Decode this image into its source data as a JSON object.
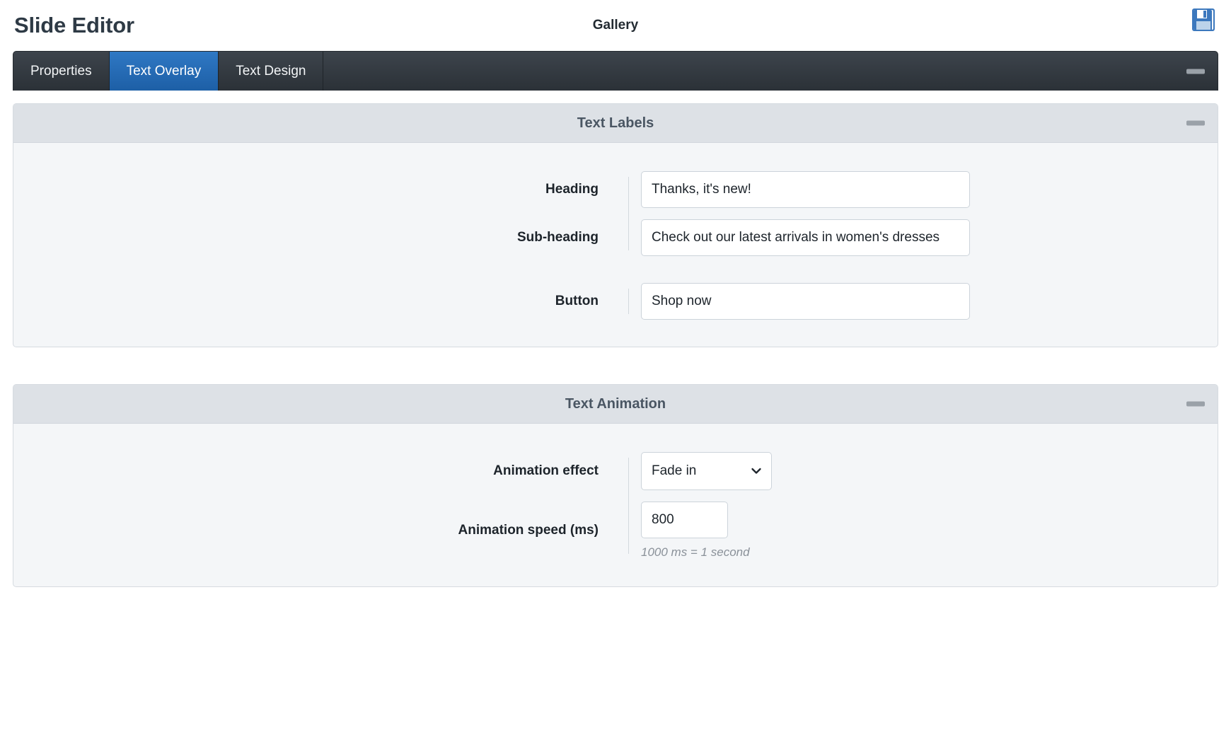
{
  "header": {
    "app_title": "Slide Editor",
    "center_title": "Gallery",
    "save_icon": "floppy-disk-save-icon",
    "save_icon_color": "#3c78bd"
  },
  "tabbar": {
    "tabs": [
      {
        "label": "Properties",
        "active": false
      },
      {
        "label": "Text Overlay",
        "active": true
      },
      {
        "label": "Text Design",
        "active": false
      }
    ],
    "minimize_icon": "minimize-dash-icon",
    "active_tab_color": "#1d5fa6"
  },
  "panels": [
    {
      "title": "Text Labels",
      "minimize_icon": "minimize-dash-icon",
      "fields": [
        {
          "label": "Heading",
          "value": "Thanks, it's new!",
          "type": "text"
        },
        {
          "label": "Sub-heading",
          "value": "Check out our latest arrivals in women's dresses",
          "type": "text"
        },
        {
          "label": "Button",
          "value": "Shop now",
          "type": "text"
        }
      ]
    },
    {
      "title": "Text Animation",
      "minimize_icon": "minimize-dash-icon",
      "fields": [
        {
          "label": "Animation effect",
          "value": "Fade in",
          "type": "select",
          "chevron_icon": "chevron-down-icon"
        },
        {
          "label": "Animation speed (ms)",
          "value": "800",
          "type": "number",
          "help": "1000 ms = 1 second"
        }
      ]
    }
  ]
}
